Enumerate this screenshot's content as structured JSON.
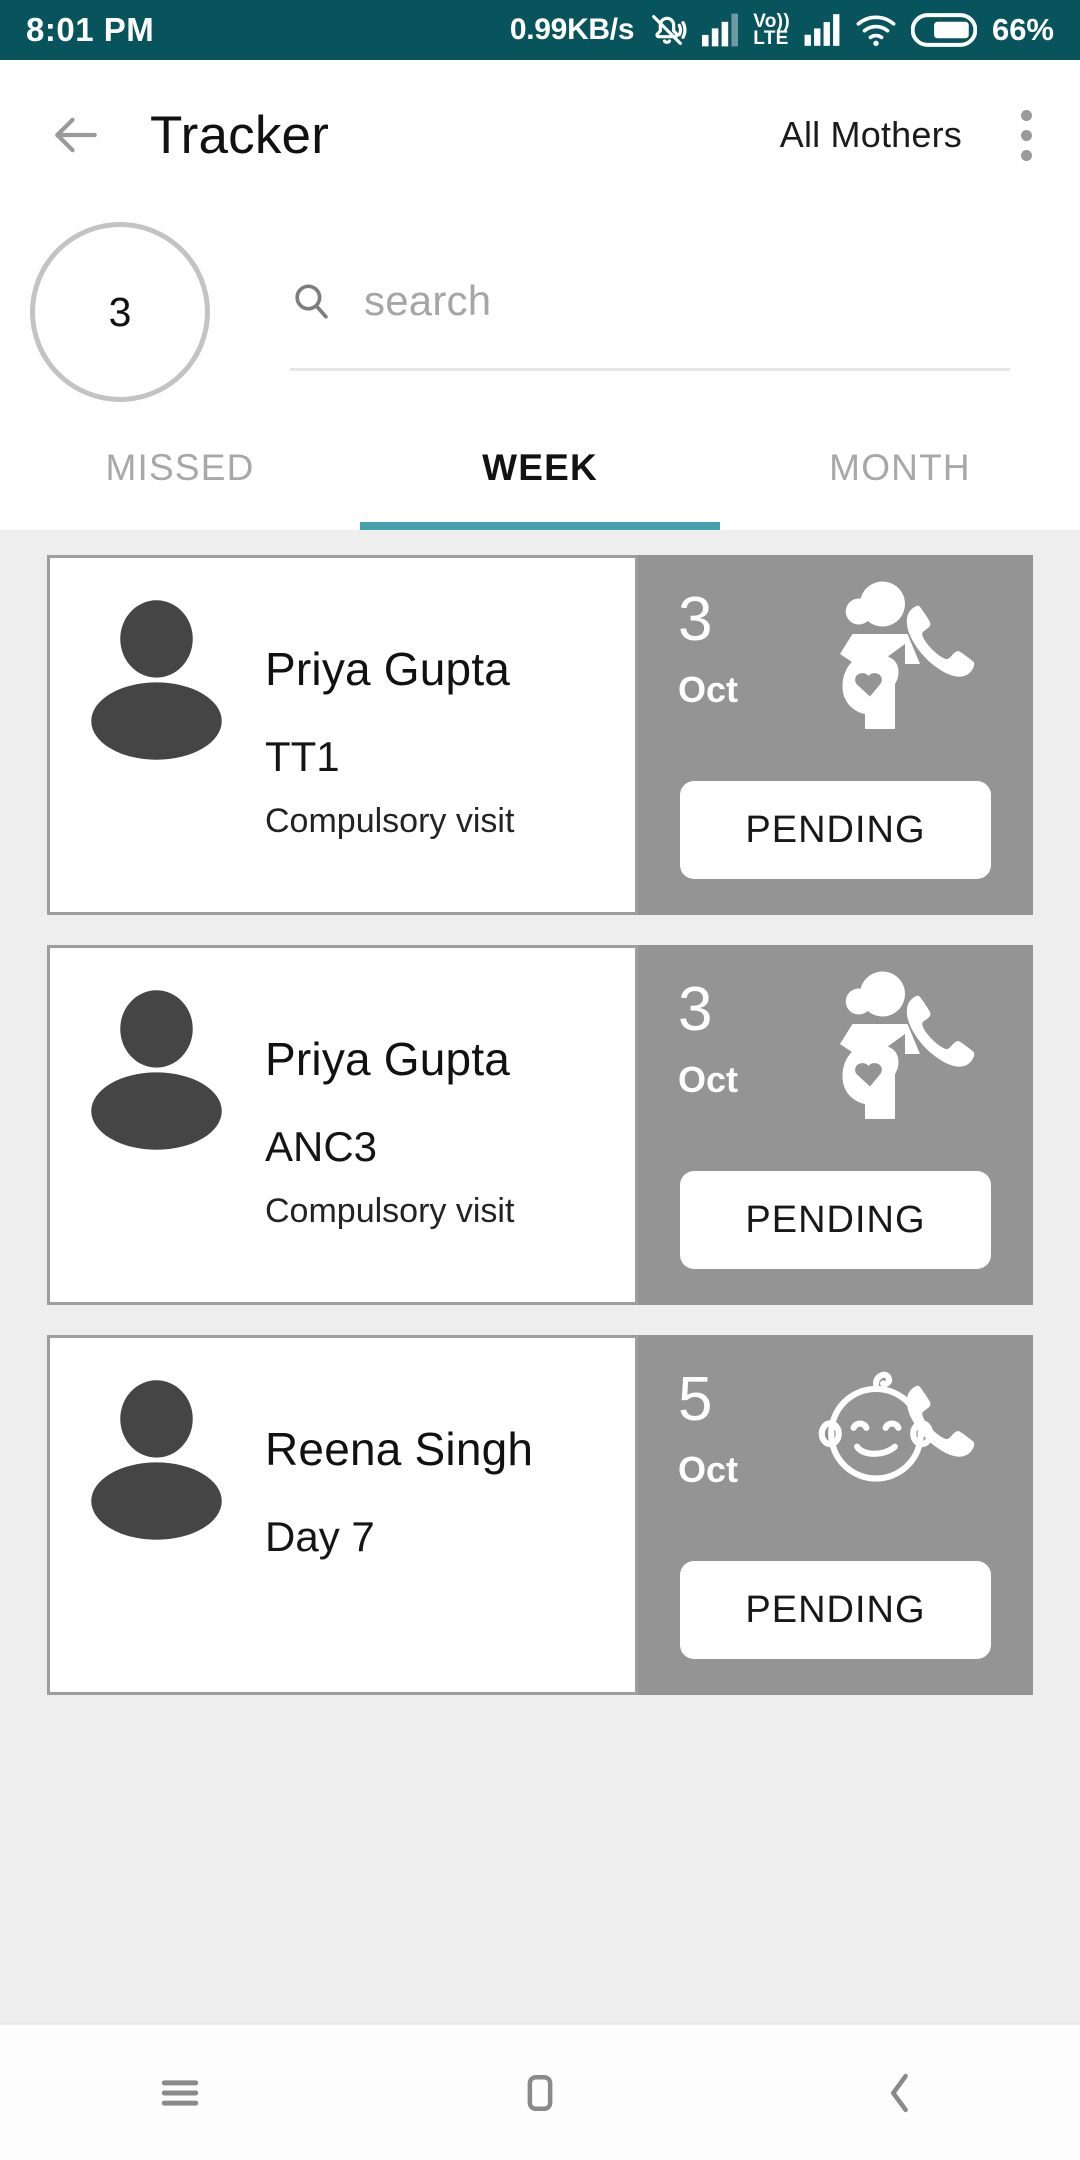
{
  "status_bar": {
    "time": "8:01 PM",
    "net_speed": "0.99KB/s",
    "volte_top": "Vo))",
    "volte_bottom": "LTE",
    "battery_percent": "66%",
    "icons": [
      "mute-bell-icon",
      "signal-bars-icon",
      "volte-icon",
      "wifi-icon",
      "battery-icon"
    ],
    "background_color": "#08545c"
  },
  "app_bar": {
    "back_icon": "back-arrow-icon",
    "title": "Tracker",
    "filter_label": "All Mothers",
    "overflow_icon": "kebab-menu-icon"
  },
  "search": {
    "count_badge": "3",
    "icon": "search-icon",
    "placeholder": "search",
    "value": ""
  },
  "tabs": {
    "items": [
      {
        "label": "MISSED",
        "active": false
      },
      {
        "label": "WEEK",
        "active": true
      },
      {
        "label": "MONTH",
        "active": false
      }
    ],
    "indicator_color": "#45a1ae"
  },
  "list": {
    "panel_color": "#949494",
    "cards": [
      {
        "avatar_icon": "person-avatar-icon",
        "name": "Priya Gupta",
        "visit_code": "TT1",
        "visit_note": "Compulsory visit",
        "day": "3",
        "month": "Oct",
        "type_icon": "pregnant-woman-icon",
        "call_icon": "phone-icon",
        "status_label": "PENDING"
      },
      {
        "avatar_icon": "person-avatar-icon",
        "name": "Priya Gupta",
        "visit_code": "ANC3",
        "visit_note": "Compulsory visit",
        "day": "3",
        "month": "Oct",
        "type_icon": "pregnant-woman-icon",
        "call_icon": "phone-icon",
        "status_label": "PENDING"
      },
      {
        "avatar_icon": "person-avatar-icon",
        "name": "Reena Singh",
        "visit_code": "Day 7",
        "visit_note": "",
        "day": "5",
        "month": "Oct",
        "type_icon": "baby-face-icon",
        "call_icon": "phone-icon",
        "status_label": "PENDING"
      }
    ]
  },
  "nav_bar": {
    "menu_icon": "menu-icon",
    "home_icon": "home-square-icon",
    "back_icon": "back-chevron-icon"
  }
}
